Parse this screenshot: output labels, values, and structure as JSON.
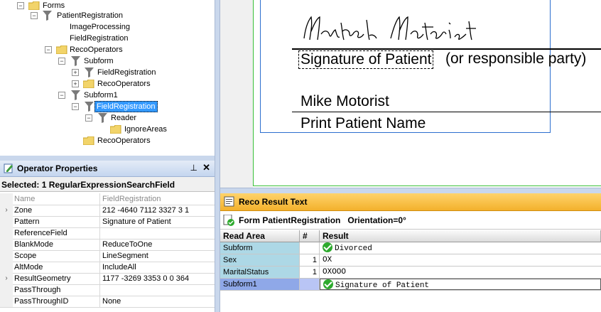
{
  "tree": {
    "nodes": [
      {
        "label": "Forms",
        "type": "folder",
        "expanded": true
      },
      {
        "label": "PatientRegistration",
        "type": "filter",
        "expanded": true
      },
      {
        "label": "ImageProcessing",
        "type": "none"
      },
      {
        "label": "FieldRegistration",
        "type": "none"
      },
      {
        "label": "RecoOperators",
        "type": "folder",
        "expanded": true
      },
      {
        "label": "Subform",
        "type": "filter",
        "expanded": true
      },
      {
        "label": "FieldRegistration",
        "type": "filter",
        "expanded": false
      },
      {
        "label": "RecoOperators",
        "type": "folder",
        "expanded": false
      },
      {
        "label": "Subform1",
        "type": "filter",
        "expanded": true
      },
      {
        "label": "FieldRegistration",
        "type": "filter",
        "expanded": true,
        "selected": true
      },
      {
        "label": "Reader",
        "type": "filter",
        "expanded": true
      },
      {
        "label": "IgnoreAreas",
        "type": "folder"
      },
      {
        "label": "RecoOperators",
        "type": "folder"
      }
    ]
  },
  "operator_properties": {
    "title": "Operator Properties",
    "pin": "ᵖ",
    "close": "✕",
    "selected_label": "Selected: 1 RegularExpressionSearchField",
    "rows": [
      {
        "name": "Name",
        "value": "FieldRegistration",
        "dim": true
      },
      {
        "name": "Zone",
        "value": "212 -4640 7112 3327 3 1",
        "expandable": true
      },
      {
        "name": "Pattern",
        "value": "Signature of Patient"
      },
      {
        "name": "ReferenceField",
        "value": ""
      },
      {
        "name": "BlankMode",
        "value": "ReduceToOne"
      },
      {
        "name": "Scope",
        "value": "LineSegment"
      },
      {
        "name": "AltMode",
        "value": "IncludeAll"
      },
      {
        "name": "ResultGeometry",
        "value": "1177 -3269 3353 0 0 364",
        "expandable": true
      },
      {
        "name": "PassThrough",
        "value": ""
      },
      {
        "name": "PassThroughID",
        "value": "None"
      }
    ]
  },
  "document": {
    "signature_label": "Signature of Patient",
    "signature_rest": "(or responsible party)",
    "printed_name": "Mike Motorist",
    "print_label": "Print Patient Name"
  },
  "reco_result": {
    "title": "Reco Result Text",
    "form_label": "Form PatientRegistration",
    "orientation": "Orientation=0°",
    "columns": [
      "Read Area",
      "#",
      "Result"
    ],
    "rows": [
      {
        "area": "Subform",
        "num": "",
        "result": "Divorced",
        "check": true
      },
      {
        "area": "Sex",
        "num": "1",
        "result": "OX",
        "check": false
      },
      {
        "area": "MaritalStatus",
        "num": "1",
        "result": "OXOOO",
        "check": false
      },
      {
        "area": "Subform1",
        "num": "",
        "result": "Signature of Patient",
        "check": true,
        "selected": true
      }
    ]
  },
  "colors": {
    "selection": "#3399ff",
    "area_cell": "#add8e6",
    "header_orange": "#f3b12c",
    "ok_green": "#2eaa2e"
  }
}
